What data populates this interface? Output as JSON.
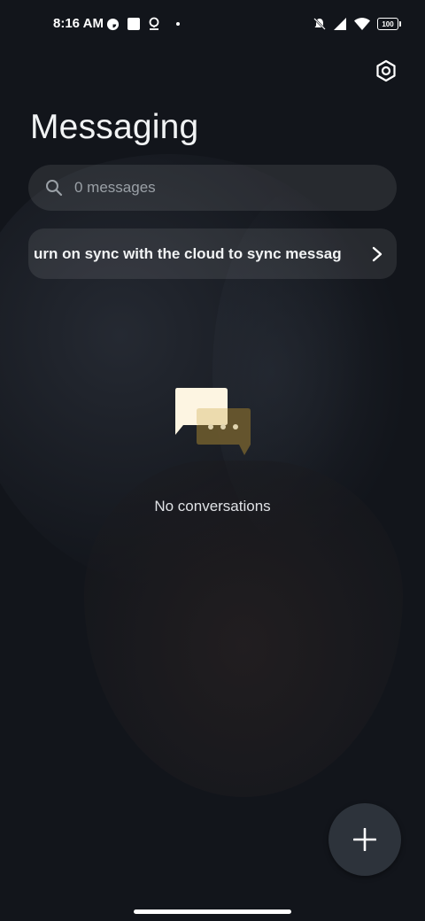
{
  "status_bar": {
    "time": "8:16 AM",
    "battery_level": "100",
    "left_icons": [
      "data-saver-icon",
      "square-notification-icon",
      "location-pin-icon",
      "dot-icon"
    ],
    "right_icons": [
      "vibrate-icon",
      "signal-icon",
      "wifi-icon",
      "battery-icon"
    ]
  },
  "header": {
    "title": "Messaging",
    "settings_icon": "settings-gear-icon"
  },
  "search": {
    "placeholder": "0 messages",
    "value": ""
  },
  "sync_banner": {
    "text": "urn on sync with the cloud to sync messag",
    "chevron": "chevron-right-icon"
  },
  "empty_state": {
    "illustration": "chat-bubbles-icon",
    "text": "No conversations"
  },
  "fab": {
    "icon": "plus-icon"
  },
  "colors": {
    "background": "#12151b",
    "card": "#23272e",
    "fab": "#2d333b",
    "bubble_front": "#fdf5e2",
    "bubble_back": "#6b5a2e"
  }
}
